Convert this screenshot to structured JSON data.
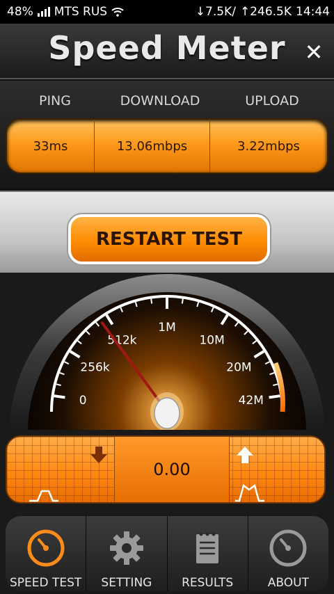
{
  "status": {
    "battery": "48%",
    "carrier": "MTS RUS",
    "download_rate": "↓7.5K/",
    "upload_rate": "↑246.5K",
    "time": "14:44"
  },
  "header": {
    "title": "Speed Meter",
    "close_glyph": "✕"
  },
  "stats": {
    "ping_label": "PING",
    "download_label": "DOWNLOAD",
    "upload_label": "UPLOAD",
    "ping_value": "33ms",
    "download_value": "13.06mbps",
    "upload_value": "3.22mbps"
  },
  "restart_label": "RESTART TEST",
  "gauge": {
    "scale": [
      "0",
      "256k",
      "512k",
      "1M",
      "10M",
      "20M",
      "42M"
    ],
    "needle_position_fraction": 0.28,
    "accent": "#ff8a13"
  },
  "speed": {
    "value": "0.00"
  },
  "tabs": [
    {
      "label": "SPEED TEST",
      "icon": "speedometer-icon",
      "active": true
    },
    {
      "label": "SETTING",
      "icon": "gear-icon",
      "active": false
    },
    {
      "label": "RESULTS",
      "icon": "notepad-icon",
      "active": false
    },
    {
      "label": "ABOUT",
      "icon": "gauge-icon",
      "active": false
    }
  ],
  "colors": {
    "accent": "#ff8a13",
    "active_tab": "#ff8c1a",
    "inactive_tab": "#9a9a9a"
  }
}
